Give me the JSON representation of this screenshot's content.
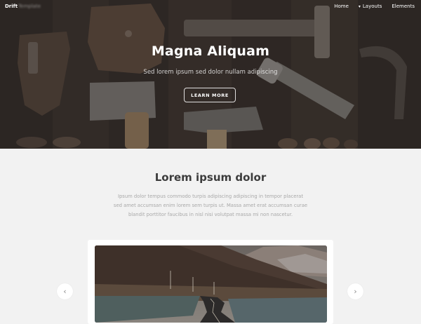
{
  "nav": {
    "brand": "Drift",
    "brand_obscured": "Template",
    "items": [
      {
        "label": "Home"
      },
      {
        "label": "Layouts"
      },
      {
        "label": "Elements"
      }
    ]
  },
  "hero": {
    "title": "Magna Aliquam",
    "subtitle": "Sed lorem ipsum sed dolor nullam adipiscing",
    "button_label": "LEARN MORE"
  },
  "section": {
    "title": "Lorem ipsum dolor",
    "lines": [
      "Ipsum dolor tempus commodo turpis adipiscing adipiscing in tempor placerat",
      "sed amet accumsan enim lorem sem turpis ut. Massa amet erat accumsan curae",
      "blandit porttitor faucibus in nisl nisi volutpat massa mi non nascetur."
    ]
  },
  "slider": {
    "prev_icon": "chevron-left-icon",
    "next_icon": "chevron-right-icon"
  },
  "colors": {
    "hero_bg": "#3b3430",
    "page_bg": "#f2f2f2",
    "title_text": "#3c3c3c",
    "body_text": "#a8a8a8"
  }
}
